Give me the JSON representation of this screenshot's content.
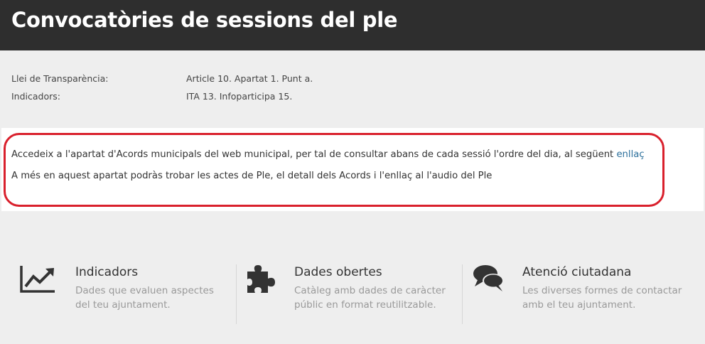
{
  "header": {
    "title": "Convocatòries de sessions del ple"
  },
  "meta": [
    {
      "key": "Llei de Transparència:",
      "value": "Article 10. Apartat 1. Punt a."
    },
    {
      "key": "Indicadors:",
      "value": "ITA 13. Infoparticipa 15."
    }
  ],
  "content": {
    "para1_text": "Accedeix a l'apartat d'Acords municipals del web municipal, per tal de consultar abans de cada sessió l'ordre del dia, al següent ",
    "para1_link": "enllaç",
    "para2_text": "A més en aquest apartat podràs trobar les actes de Ple, el detall dels Acords i l'enllaç al l'audio del Ple"
  },
  "features": [
    {
      "icon": "trend-chart-icon",
      "title": "Indicadors",
      "desc": "Dades que evaluen aspectes del teu ajuntament."
    },
    {
      "icon": "puzzle-icon",
      "title": "Dades obertes",
      "desc": "Catàleg amb dades de caràcter públic en format reutilitzable."
    },
    {
      "icon": "chat-bubbles-icon",
      "title": "Atenció ciutadana",
      "desc": "Les diverses formes de contactar amb el teu ajuntament."
    }
  ],
  "colors": {
    "header_bg": "#2e2e2e",
    "highlight": "#d9202c",
    "link": "#2b6f9b"
  }
}
